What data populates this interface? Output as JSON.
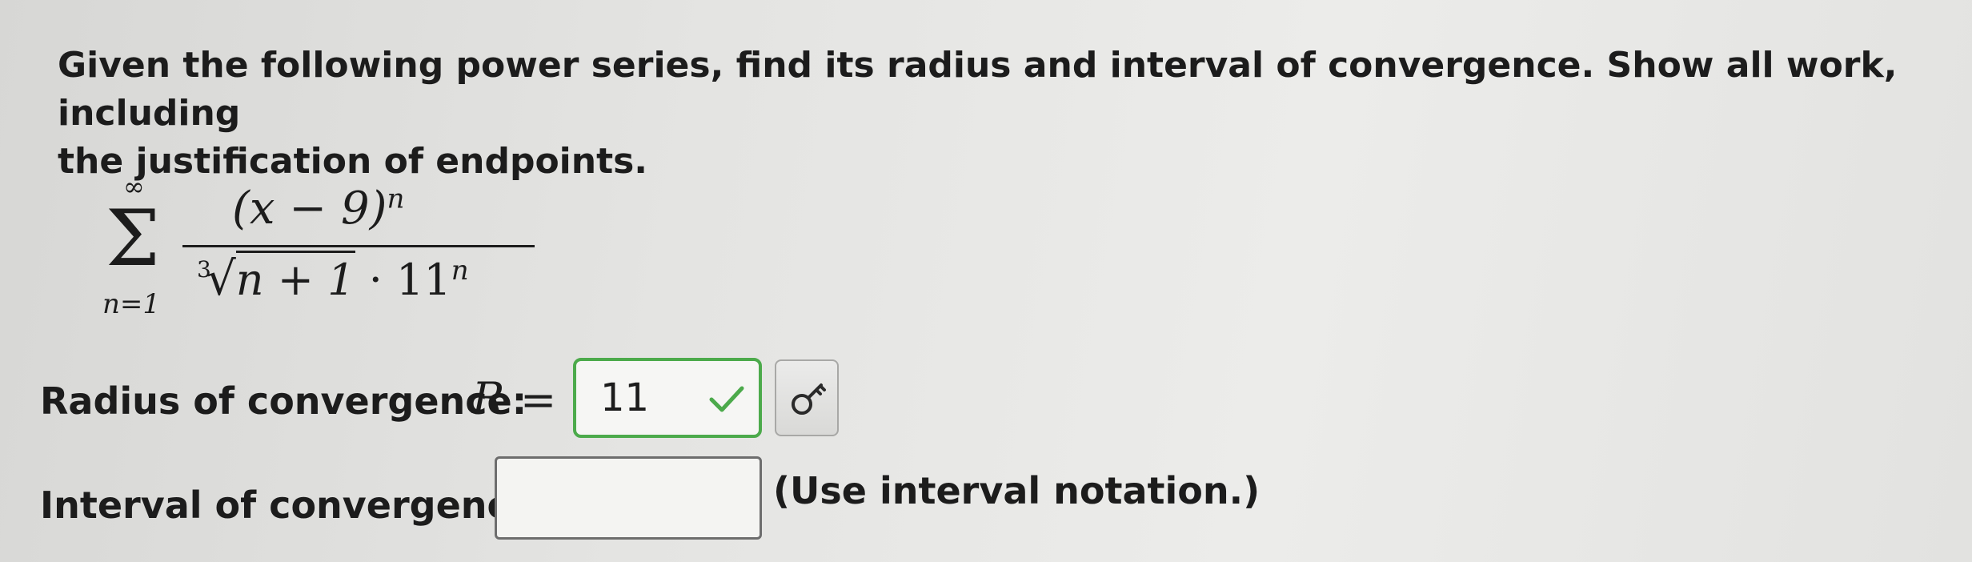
{
  "question": {
    "prompt_line1": "Given the following power series, find its radius and interval of convergence. Show all work, including",
    "prompt_line2": "the justification of endpoints."
  },
  "series": {
    "upper_limit": "∞",
    "lower_limit": "n=1",
    "numerator_base": "(x − 9)",
    "numerator_exponent": "n",
    "denominator_root_index": "3",
    "denominator_radicand": "n + 1",
    "denominator_factor": "· 11",
    "denominator_exponent": "n"
  },
  "radius": {
    "label": "Radius of convergence:",
    "symbol": "R",
    "equals": "=",
    "value": "11",
    "status": "correct",
    "status_color": "#4caa4b",
    "key_icon": "key-icon"
  },
  "interval": {
    "label": "Interval of convergence:",
    "value": "",
    "hint": "(Use interval notation.)"
  }
}
